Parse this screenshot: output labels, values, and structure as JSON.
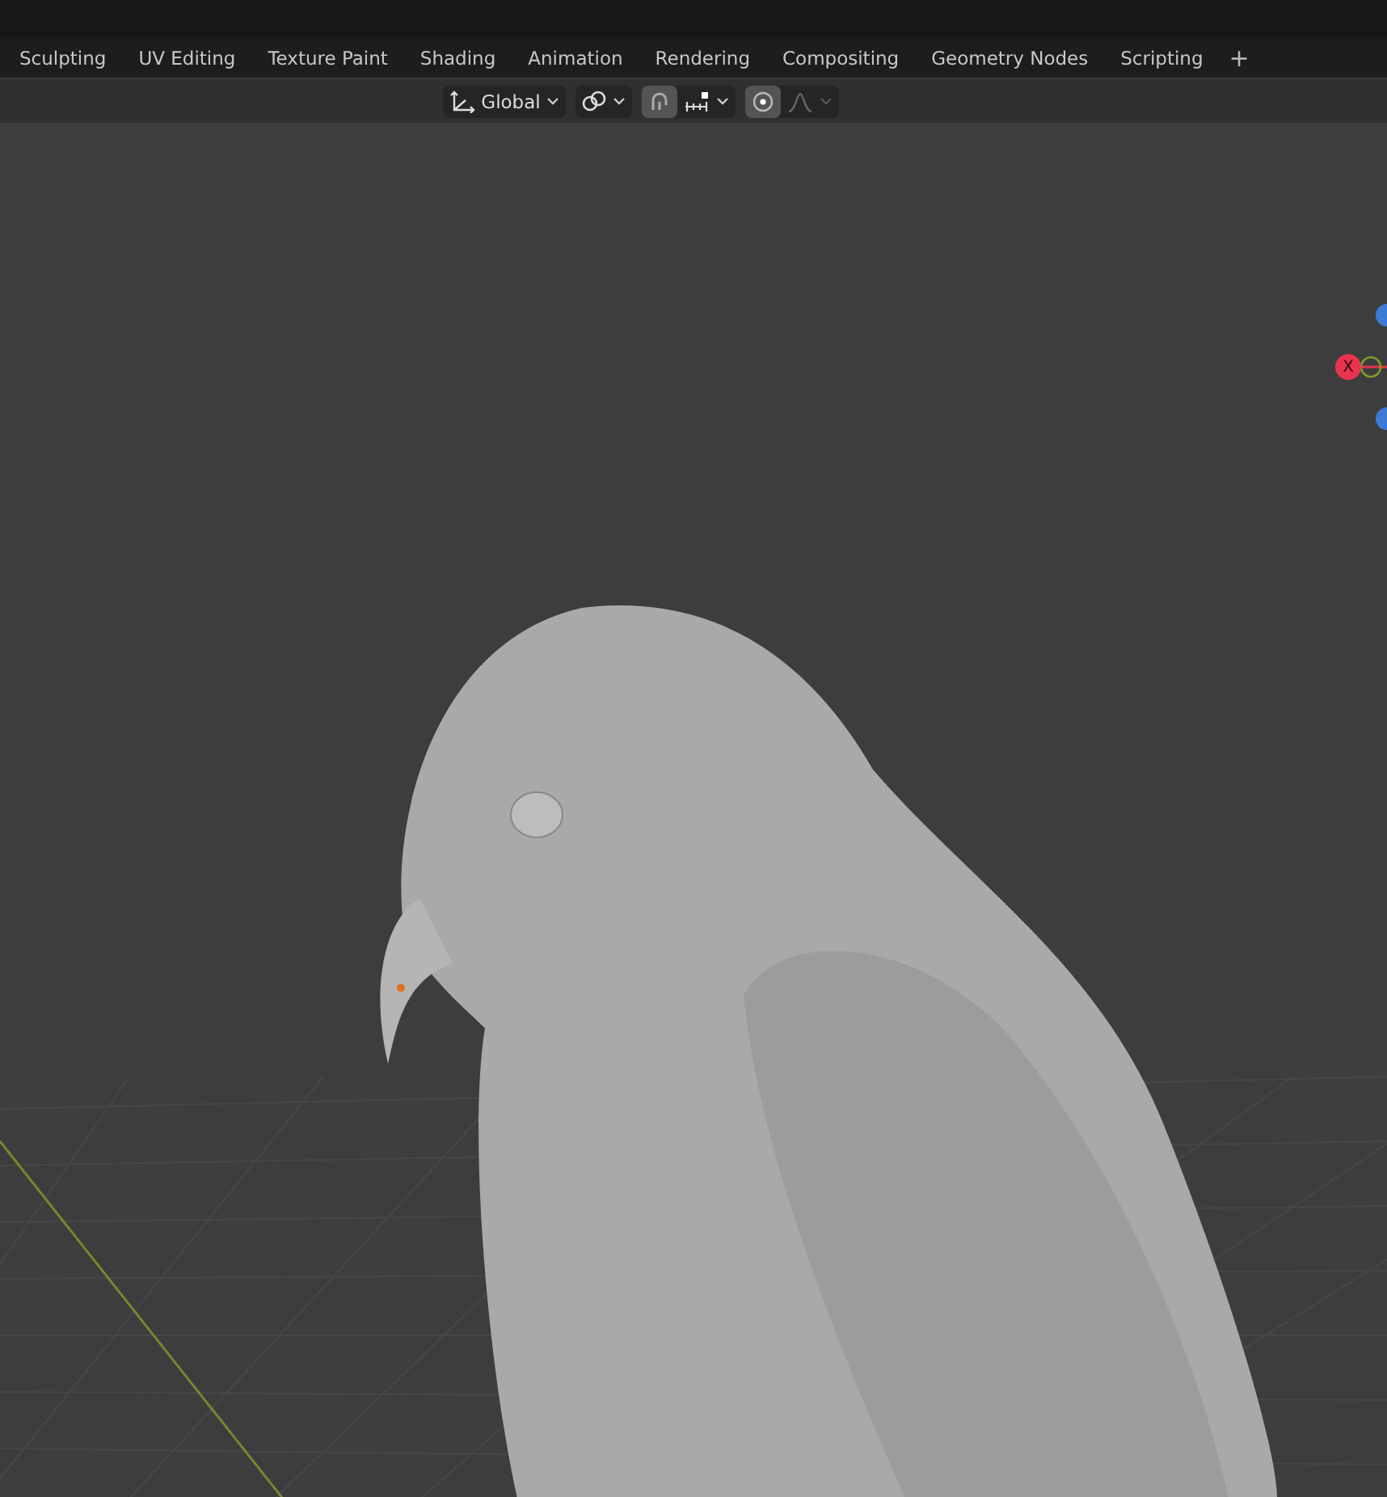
{
  "workspace_tabs": [
    {
      "label": "Sculpting",
      "selected": false
    },
    {
      "label": "UV Editing",
      "selected": false
    },
    {
      "label": "Texture Paint",
      "selected": false
    },
    {
      "label": "Shading",
      "selected": false
    },
    {
      "label": "Animation",
      "selected": false
    },
    {
      "label": "Rendering",
      "selected": false
    },
    {
      "label": "Compositing",
      "selected": false
    },
    {
      "label": "Geometry Nodes",
      "selected": false
    },
    {
      "label": "Scripting",
      "selected": false
    }
  ],
  "add_tab": "+",
  "header": {
    "orientation": {
      "value": "Global"
    },
    "snap": {
      "on": true
    },
    "proportional_edit": {
      "on": true
    },
    "falloff": {
      "disabled": true
    }
  },
  "viewport": {
    "gizmo": {
      "x_label": "X"
    }
  }
}
